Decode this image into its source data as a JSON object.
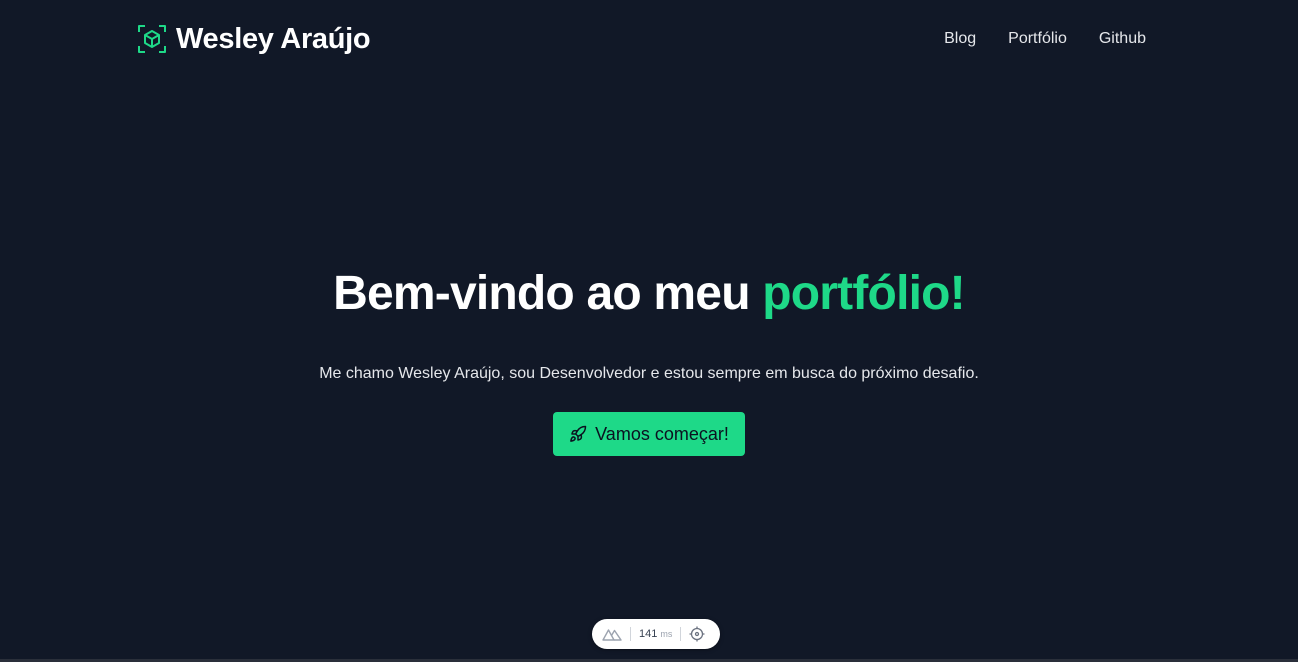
{
  "brand": {
    "name": "Wesley Araújo",
    "icon": "cube-icon"
  },
  "nav": {
    "items": [
      {
        "label": "Blog"
      },
      {
        "label": "Portfólio"
      },
      {
        "label": "Github"
      }
    ]
  },
  "hero": {
    "title_prefix": "Bem-vindo ao meu ",
    "title_accent": "portfólio!",
    "subtitle": "Me chamo Wesley Araújo, sou Desenvolvedor e estou sempre em busca do próximo desafio.",
    "cta_label": "Vamos começar!",
    "cta_icon": "rocket-icon"
  },
  "devtools": {
    "render_time": "141",
    "unit": "ms",
    "logo_icon": "nuxt-logo-icon",
    "inspect_icon": "crosshair-icon"
  },
  "colors": {
    "background": "#111827",
    "accent": "#1ed988",
    "text": "#ffffff"
  }
}
